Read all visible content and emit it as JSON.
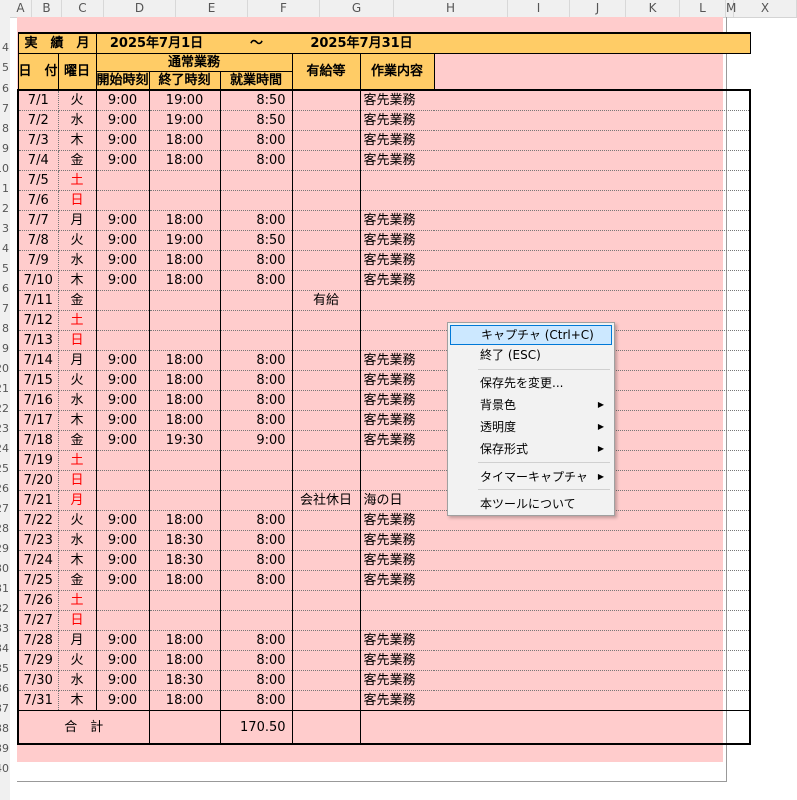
{
  "columns": [
    "A",
    "B",
    "C",
    "D",
    "E",
    "F",
    "G",
    "H",
    "I",
    "J",
    "K",
    "L",
    "M",
    "X"
  ],
  "row_numbers": [
    "4",
    "5",
    "6",
    "7",
    "8",
    "9",
    "10",
    "1",
    "2",
    "3",
    "4",
    "5",
    "6",
    "7",
    "8",
    "9",
    "20",
    "21",
    "22",
    "23",
    "24",
    "25",
    "26",
    "27",
    "28",
    "29",
    "30",
    "31",
    "32",
    "33",
    "34",
    "35",
    "36",
    "37",
    "38",
    "39",
    "40"
  ],
  "header": {
    "period_label": "実　績　月",
    "start_date": "2025年7月1日",
    "tilde": "～",
    "end_date": "2025年7月31日",
    "date_label": "日　付",
    "weekday_label": "曜日",
    "normal_work_label": "通常業務",
    "paid_leave_label": "有給等",
    "work_content_label": "作業内容",
    "start_time_label": "開始時刻",
    "end_time_label": "終了時刻",
    "work_hours_label": "就業時間"
  },
  "rows": [
    {
      "date": "7/1",
      "wd": "火",
      "start": "9:00",
      "end": "19:00",
      "hours": "8:50",
      "leave": "",
      "work": "客先業務",
      "red": false
    },
    {
      "date": "7/2",
      "wd": "水",
      "start": "9:00",
      "end": "19:00",
      "hours": "8:50",
      "leave": "",
      "work": "客先業務",
      "red": false
    },
    {
      "date": "7/3",
      "wd": "木",
      "start": "9:00",
      "end": "18:00",
      "hours": "8:00",
      "leave": "",
      "work": "客先業務",
      "red": false
    },
    {
      "date": "7/4",
      "wd": "金",
      "start": "9:00",
      "end": "18:00",
      "hours": "8:00",
      "leave": "",
      "work": "客先業務",
      "red": false
    },
    {
      "date": "7/5",
      "wd": "土",
      "start": "",
      "end": "",
      "hours": "",
      "leave": "",
      "work": "",
      "red": true
    },
    {
      "date": "7/6",
      "wd": "日",
      "start": "",
      "end": "",
      "hours": "",
      "leave": "",
      "work": "",
      "red": true
    },
    {
      "date": "7/7",
      "wd": "月",
      "start": "9:00",
      "end": "18:00",
      "hours": "8:00",
      "leave": "",
      "work": "客先業務",
      "red": false
    },
    {
      "date": "7/8",
      "wd": "火",
      "start": "9:00",
      "end": "19:00",
      "hours": "8:50",
      "leave": "",
      "work": "客先業務",
      "red": false
    },
    {
      "date": "7/9",
      "wd": "水",
      "start": "9:00",
      "end": "18:00",
      "hours": "8:00",
      "leave": "",
      "work": "客先業務",
      "red": false
    },
    {
      "date": "7/10",
      "wd": "木",
      "start": "9:00",
      "end": "18:00",
      "hours": "8:00",
      "leave": "",
      "work": "客先業務",
      "red": false
    },
    {
      "date": "7/11",
      "wd": "金",
      "start": "",
      "end": "",
      "hours": "",
      "leave": "有給",
      "work": "",
      "red": false
    },
    {
      "date": "7/12",
      "wd": "土",
      "start": "",
      "end": "",
      "hours": "",
      "leave": "",
      "work": "",
      "red": true
    },
    {
      "date": "7/13",
      "wd": "日",
      "start": "",
      "end": "",
      "hours": "",
      "leave": "",
      "work": "",
      "red": true
    },
    {
      "date": "7/14",
      "wd": "月",
      "start": "9:00",
      "end": "18:00",
      "hours": "8:00",
      "leave": "",
      "work": "客先業務",
      "red": false
    },
    {
      "date": "7/15",
      "wd": "火",
      "start": "9:00",
      "end": "18:00",
      "hours": "8:00",
      "leave": "",
      "work": "客先業務",
      "red": false
    },
    {
      "date": "7/16",
      "wd": "水",
      "start": "9:00",
      "end": "18:00",
      "hours": "8:00",
      "leave": "",
      "work": "客先業務",
      "red": false
    },
    {
      "date": "7/17",
      "wd": "木",
      "start": "9:00",
      "end": "18:00",
      "hours": "8:00",
      "leave": "",
      "work": "客先業務",
      "red": false
    },
    {
      "date": "7/18",
      "wd": "金",
      "start": "9:00",
      "end": "19:30",
      "hours": "9:00",
      "leave": "",
      "work": "客先業務",
      "red": false
    },
    {
      "date": "7/19",
      "wd": "土",
      "start": "",
      "end": "",
      "hours": "",
      "leave": "",
      "work": "",
      "red": true
    },
    {
      "date": "7/20",
      "wd": "日",
      "start": "",
      "end": "",
      "hours": "",
      "leave": "",
      "work": "",
      "red": true
    },
    {
      "date": "7/21",
      "wd": "月",
      "start": "",
      "end": "",
      "hours": "",
      "leave": "会社休日",
      "work": "海の日",
      "red": true
    },
    {
      "date": "7/22",
      "wd": "火",
      "start": "9:00",
      "end": "18:00",
      "hours": "8:00",
      "leave": "",
      "work": "客先業務",
      "red": false
    },
    {
      "date": "7/23",
      "wd": "水",
      "start": "9:00",
      "end": "18:30",
      "hours": "8:00",
      "leave": "",
      "work": "客先業務",
      "red": false
    },
    {
      "date": "7/24",
      "wd": "木",
      "start": "9:00",
      "end": "18:30",
      "hours": "8:00",
      "leave": "",
      "work": "客先業務",
      "red": false
    },
    {
      "date": "7/25",
      "wd": "金",
      "start": "9:00",
      "end": "18:00",
      "hours": "8:00",
      "leave": "",
      "work": "客先業務",
      "red": false
    },
    {
      "date": "7/26",
      "wd": "土",
      "start": "",
      "end": "",
      "hours": "",
      "leave": "",
      "work": "",
      "red": true
    },
    {
      "date": "7/27",
      "wd": "日",
      "start": "",
      "end": "",
      "hours": "",
      "leave": "",
      "work": "",
      "red": true
    },
    {
      "date": "7/28",
      "wd": "月",
      "start": "9:00",
      "end": "18:00",
      "hours": "8:00",
      "leave": "",
      "work": "客先業務",
      "red": false
    },
    {
      "date": "7/29",
      "wd": "火",
      "start": "9:00",
      "end": "18:00",
      "hours": "8:00",
      "leave": "",
      "work": "客先業務",
      "red": false
    },
    {
      "date": "7/30",
      "wd": "水",
      "start": "9:00",
      "end": "18:30",
      "hours": "8:00",
      "leave": "",
      "work": "客先業務",
      "red": false
    },
    {
      "date": "7/31",
      "wd": "木",
      "start": "9:00",
      "end": "18:00",
      "hours": "8:00",
      "leave": "",
      "work": "客先業務",
      "red": false
    }
  ],
  "total": {
    "label": "合　計",
    "hours": "170.50"
  },
  "context_menu": {
    "items": [
      {
        "label": "キャプチャ (Ctrl+C)",
        "submenu": false,
        "highlighted": true
      },
      {
        "label": "終了 (ESC)",
        "submenu": false
      },
      {
        "label": "保存先を変更...",
        "submenu": false
      },
      {
        "label": "背景色",
        "submenu": true
      },
      {
        "label": "透明度",
        "submenu": true
      },
      {
        "label": "保存形式",
        "submenu": true
      },
      {
        "label": "タイマーキャプチャ",
        "submenu": true
      },
      {
        "label": "本ツールについて",
        "submenu": false
      }
    ],
    "arrow_glyph": "▶"
  }
}
